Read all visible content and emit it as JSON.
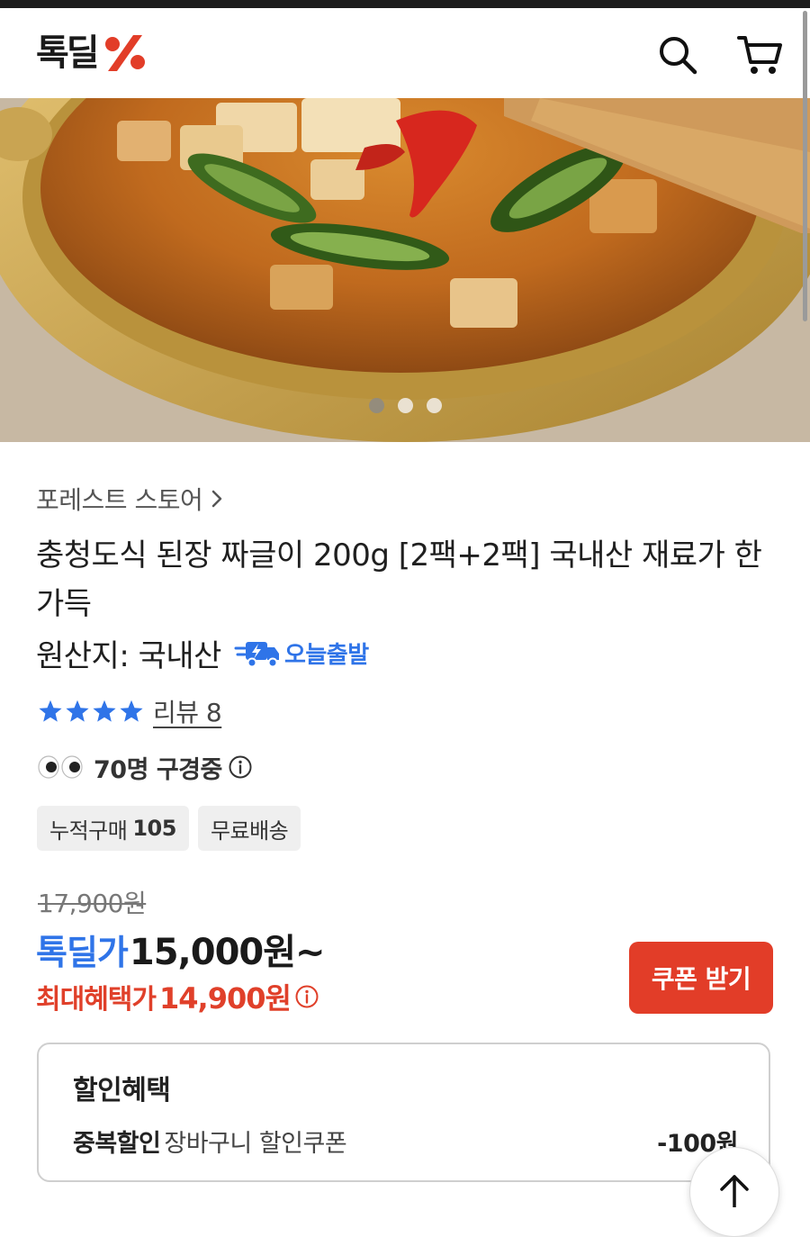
{
  "header": {
    "logo_text": "톡딜",
    "logo_symbol": "%",
    "icons": [
      "search-icon",
      "cart-icon"
    ]
  },
  "hero": {
    "image_description": "",
    "slide_count": 3,
    "active_slide": 1
  },
  "product": {
    "store_name": "포레스트 스토어",
    "title": "충청도식 된장 짜글이 200g [2팩+2팩] 국내산 재료가 한가득",
    "origin": "원산지: 국내산",
    "shipping_badge": "오늘출발",
    "rating_stars": 4,
    "review_label": "리뷰 8",
    "viewers": "70명 구경중",
    "chips": [
      {
        "label": "누적구매",
        "value": "105"
      },
      {
        "label": "무료배송",
        "value": ""
      }
    ]
  },
  "price": {
    "original": "17,900원",
    "deal_label": "톡딜가",
    "deal_price": "15,000원~",
    "max_label": "최대혜택가",
    "max_price": "14,900원"
  },
  "coupon_button": "쿠폰 받기",
  "discount": {
    "title": "할인혜택",
    "rows": [
      {
        "type": "중복할인",
        "name": "장바구니 할인쿠폰",
        "amount": "-100원"
      }
    ]
  },
  "colors": {
    "accent_blue": "#2f74e8",
    "accent_red": "#e23d28",
    "star_blue": "#2f74e8"
  }
}
